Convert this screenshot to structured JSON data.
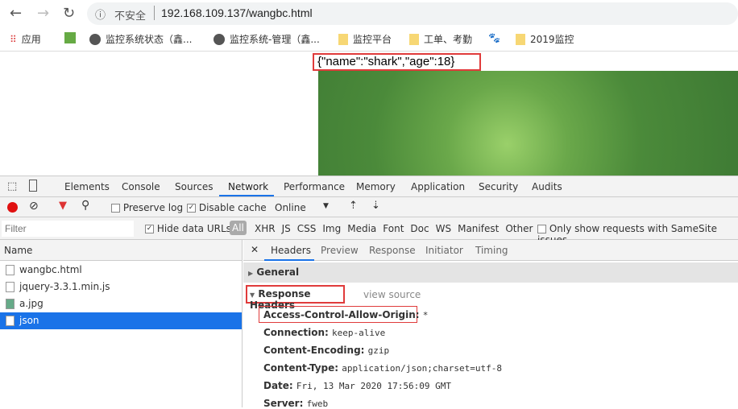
{
  "browser": {
    "security_label": "不安全",
    "url": "192.168.109.137/wangbc.html"
  },
  "bookmarks": [
    "应用",
    "监控系统状态（鑫...",
    "监控系统-管理（鑫...",
    "监控平台",
    "工单、考勤",
    "2019监控"
  ],
  "page": {
    "json_text": "{\"name\":\"shark\",\"age\":18}"
  },
  "devtools": {
    "tabs": [
      "Elements",
      "Console",
      "Sources",
      "Network",
      "Performance",
      "Memory",
      "Application",
      "Security",
      "Audits"
    ],
    "active_tab": "Network",
    "toolbar": {
      "preserve_log": "Preserve log",
      "disable_cache": "Disable cache",
      "throttle": "Online"
    },
    "filter": {
      "placeholder": "Filter",
      "hide_data_urls": "Hide data URLs",
      "all": "All",
      "types": [
        "XHR",
        "JS",
        "CSS",
        "Img",
        "Media",
        "Font",
        "Doc",
        "WS",
        "Manifest",
        "Other"
      ],
      "samesite": "Only show requests with SameSite issues"
    },
    "requests": {
      "header": "Name",
      "items": [
        "wangbc.html",
        "jquery-3.3.1.min.js",
        "a.jpg",
        "json"
      ],
      "selected": "json"
    },
    "detail": {
      "tabs": [
        "Headers",
        "Preview",
        "Response",
        "Initiator",
        "Timing"
      ],
      "general": "General",
      "response_headers": "Response Headers",
      "view_source": "view source",
      "headers": [
        {
          "name": "Access-Control-Allow-Origin:",
          "value": "*"
        },
        {
          "name": "Connection:",
          "value": "keep-alive"
        },
        {
          "name": "Content-Encoding:",
          "value": "gzip"
        },
        {
          "name": "Content-Type:",
          "value": "application/json;charset=utf-8"
        },
        {
          "name": "Date:",
          "value": "Fri, 13 Mar 2020 17:56:09 GMT"
        },
        {
          "name": "Server:",
          "value": "fweb"
        }
      ]
    }
  }
}
